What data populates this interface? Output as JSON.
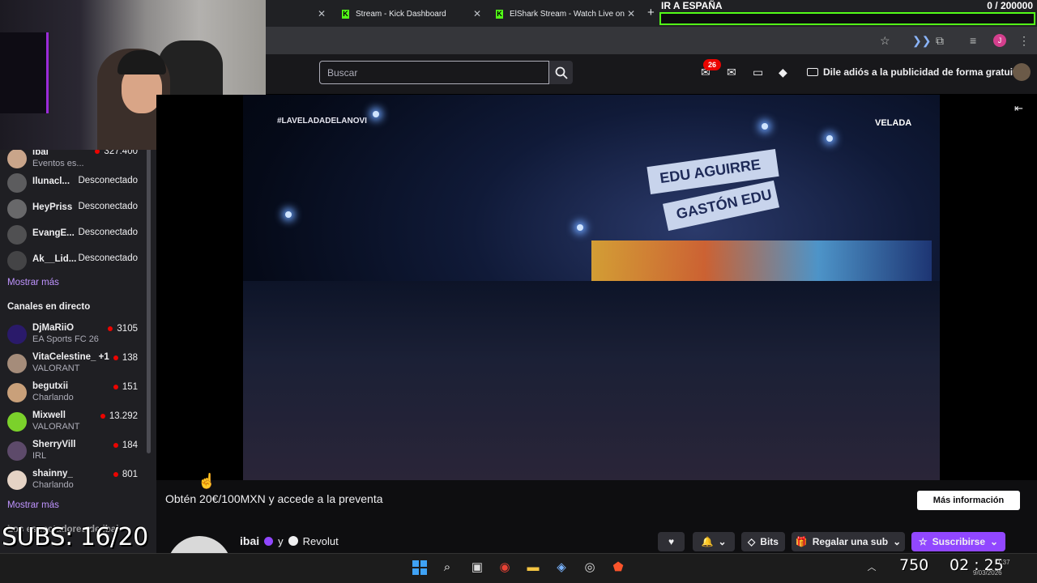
{
  "browser": {
    "tabs": [
      {
        "label": "Stream - Kick Dashboard"
      },
      {
        "label": "ElShark Stream - Watch Live on"
      }
    ],
    "new_tab_icon": "plus-icon"
  },
  "overlay": {
    "goal_title": "IR A ESPAÑA",
    "goal_count": "0 / 200000",
    "subs_text": "SUBS: 16/20",
    "accent_color": "#53fc18"
  },
  "topnav": {
    "search_placeholder": "Buscar",
    "notification_count": "26",
    "adfree_label": "Dile adiós a la publicidad de forma gratuita"
  },
  "sidebar": {
    "followed": [
      {
        "name": "ibai",
        "sub": "Eventos es...",
        "viewers": "327.400",
        "online": true
      },
      {
        "name": "Ilunacl...",
        "status": "Desconectado",
        "online": false
      },
      {
        "name": "HeyPriss",
        "status": "Desconectado",
        "online": false
      },
      {
        "name": "EvangE...",
        "status": "Desconectado",
        "online": false
      },
      {
        "name": "Ak__Lid...",
        "status": "Desconectado",
        "online": false
      }
    ],
    "show_more_1": "Mostrar más",
    "live_heading": "Canales en directo",
    "live": [
      {
        "name": "DjMaRiiO",
        "game": "EA Sports FC 26",
        "viewers": "3105"
      },
      {
        "name": "VitaCelestine_ +1",
        "game": "VALORANT",
        "viewers": "138"
      },
      {
        "name": "begutxii",
        "game": "Charlando",
        "viewers": "151"
      },
      {
        "name": "Mixwell",
        "game": "VALORANT",
        "viewers": "13.292"
      },
      {
        "name": "SherryVill",
        "game": "IRL",
        "viewers": "184"
      },
      {
        "name": "shainny_",
        "game": "Charlando",
        "viewers": "801"
      }
    ],
    "show_more_2": "Mostrar más",
    "partial_heading": "Los espectadores de ibai"
  },
  "video": {
    "hashtag": "#LAVELADADELANOVI",
    "logo_text_1": "VELADA",
    "banner_1": "EDU AGUIRRE",
    "banner_2": "GASTÓN EDU"
  },
  "below_video": {
    "promo_text": "Obtén 20€/100MXN y accede a la preventa",
    "promo_button": "Más información",
    "channel_name": "ibai",
    "channel_and": "y",
    "partner_name": "Revolut",
    "bits_label": "Bits",
    "gift_label": "Regalar una sub",
    "subscribe_label": "Suscribirse"
  },
  "taskbar": {
    "tray_count": "750",
    "tray_time_big": "02 : 25",
    "clock_time": "1:37",
    "clock_date": "9/03/2026"
  }
}
